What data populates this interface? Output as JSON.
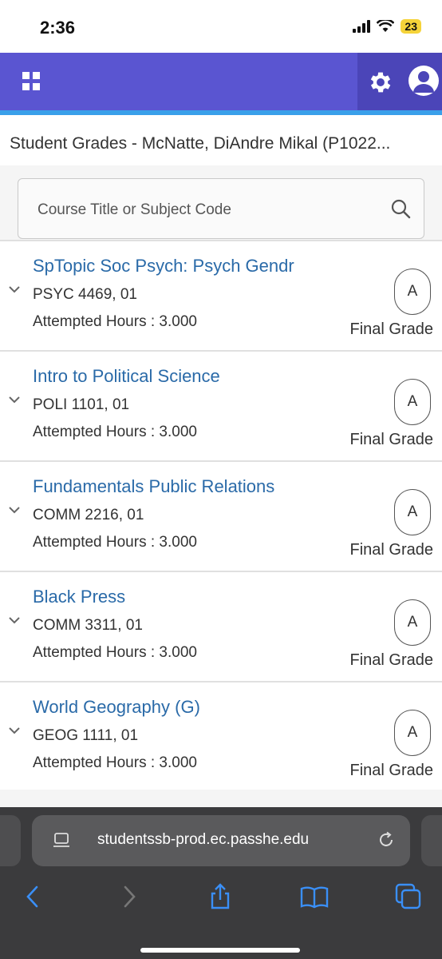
{
  "status": {
    "time": "2:36",
    "battery": "23"
  },
  "header": {
    "menu_icon": "grid-icon",
    "settings_icon": "gear-icon",
    "user_icon": "user-icon",
    "brand_color": "#5a55d1",
    "accent_color": "#3aa0ea"
  },
  "page": {
    "title": "Student Grades - McNatte, DiAndre Mikal (P1022..."
  },
  "search": {
    "placeholder": "Course Title or Subject Code"
  },
  "courses": [
    {
      "title": "SpTopic Soc Psych: Psych Gendr",
      "code": "PSYC 4469, 01",
      "hours": "Attempted Hours : 3.000",
      "grade": "A",
      "grade_label": "Final Grade"
    },
    {
      "title": "Intro to Political Science",
      "code": "POLI 1101, 01",
      "hours": "Attempted Hours : 3.000",
      "grade": "A",
      "grade_label": "Final Grade"
    },
    {
      "title": "Fundamentals Public Relations",
      "code": "COMM 2216, 01",
      "hours": "Attempted Hours : 3.000",
      "grade": "A",
      "grade_label": "Final Grade"
    },
    {
      "title": "Black Press",
      "code": "COMM 3311, 01",
      "hours": "Attempted Hours : 3.000",
      "grade": "A",
      "grade_label": "Final Grade"
    },
    {
      "title": "World Geography (G)",
      "code": "GEOG 1111, 01",
      "hours": "Attempted Hours : 3.000",
      "grade": "A",
      "grade_label": "Final Grade"
    }
  ],
  "browser": {
    "url": "studentssb-prod.ec.passhe.edu",
    "toolbar_icons": [
      "back-icon",
      "forward-icon",
      "share-icon",
      "bookmarks-icon",
      "tabs-icon"
    ]
  }
}
